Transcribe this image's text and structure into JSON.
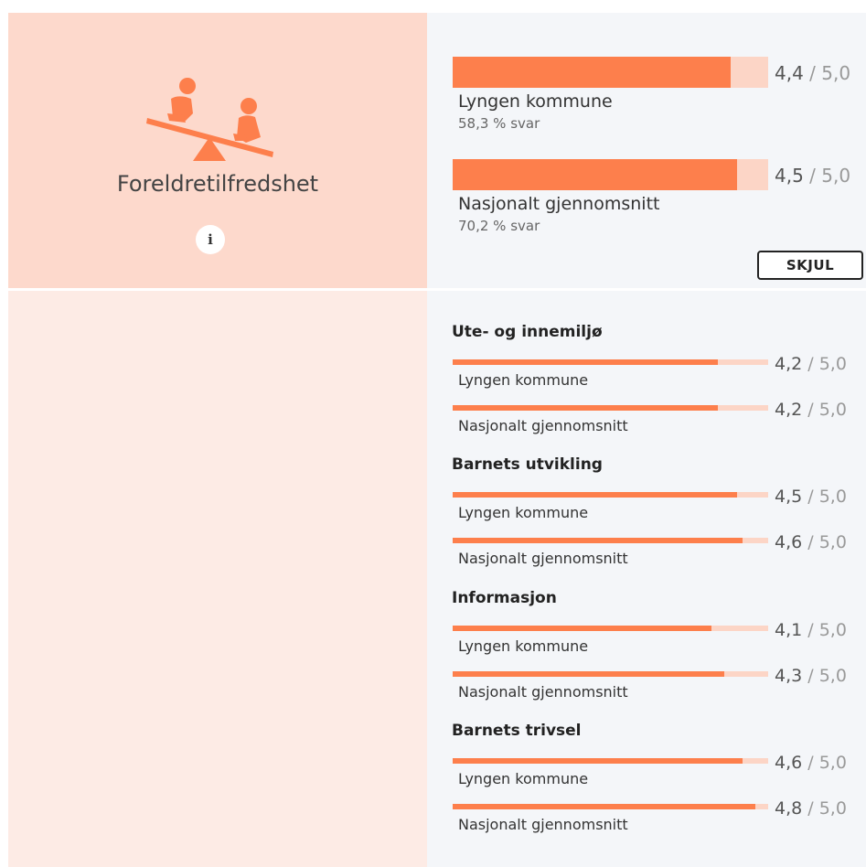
{
  "summary": {
    "title": "Foreldretilfredshet",
    "info_icon": "i",
    "rows": [
      {
        "label": "Lyngen kommune",
        "score": "4,4",
        "max": "5,0",
        "fraction": 0.88,
        "response": "58,3 % svar"
      },
      {
        "label": "Nasjonalt gjennomsnitt",
        "score": "4,5",
        "max": "5,0",
        "fraction": 0.9,
        "response": "70,2 % svar"
      }
    ],
    "hide_label": "SKJUL"
  },
  "categories": [
    {
      "title": "Ute- og innemiljø",
      "rows": [
        {
          "label": "Lyngen kommune",
          "score": "4,2",
          "max": "5,0",
          "fraction": 0.84
        },
        {
          "label": "Nasjonalt gjennomsnitt",
          "score": "4,2",
          "max": "5,0",
          "fraction": 0.84
        }
      ]
    },
    {
      "title": "Barnets utvikling",
      "rows": [
        {
          "label": "Lyngen kommune",
          "score": "4,5",
          "max": "5,0",
          "fraction": 0.9
        },
        {
          "label": "Nasjonalt gjennomsnitt",
          "score": "4,6",
          "max": "5,0",
          "fraction": 0.92
        }
      ]
    },
    {
      "title": "Informasjon",
      "rows": [
        {
          "label": "Lyngen kommune",
          "score": "4,1",
          "max": "5,0",
          "fraction": 0.82
        },
        {
          "label": "Nasjonalt gjennomsnitt",
          "score": "4,3",
          "max": "5,0",
          "fraction": 0.86
        }
      ]
    },
    {
      "title": "Barnets trivsel",
      "rows": [
        {
          "label": "Lyngen kommune",
          "score": "4,6",
          "max": "5,0",
          "fraction": 0.92
        },
        {
          "label": "Nasjonalt gjennomsnitt",
          "score": "4,8",
          "max": "5,0",
          "fraction": 0.96
        }
      ]
    }
  ],
  "colors": {
    "accent": "#fd7f4c",
    "track": "#fcd5c6"
  },
  "icons": {
    "seesaw": "seesaw-icon",
    "info": "info-icon"
  }
}
